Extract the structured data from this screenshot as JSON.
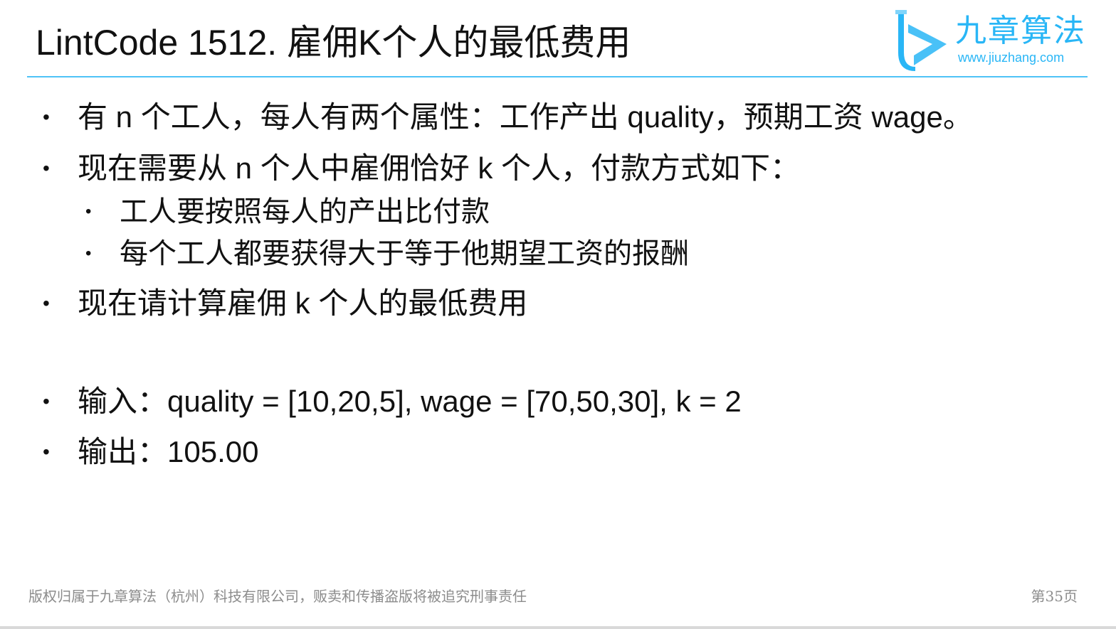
{
  "slide": {
    "title": "LintCode 1512. 雇佣K个人的最低费用",
    "logo": {
      "name": "九章算法",
      "url": "www.jiuzhang.com",
      "icon": "jiuzhang-logo-mark"
    },
    "bullet_symbol": "•",
    "bullets": [
      "有 n 个工人，每人有两个属性：工作产出 quality，预期工资 wage。",
      "现在需要从 n 个人中雇佣恰好 k 个人，付款方式如下：",
      "现在请计算雇佣 k 个人的最低费用",
      "输入：quality = [10,20,5], wage = [70,50,30], k = 2",
      "输出：105.00"
    ],
    "sub_bullets": [
      "工人要按照每人的产出比付款",
      "每个工人都要获得大于等于他期望工资的报酬"
    ],
    "footer": "版权归属于九章算法（杭州）科技有限公司，贩卖和传播盗版将被追究刑事责任",
    "page": "第35页",
    "colors": {
      "accent": "#29b6f6",
      "rule": "#4fc3f7",
      "text": "#111111",
      "footer": "#8c8c8c"
    }
  }
}
